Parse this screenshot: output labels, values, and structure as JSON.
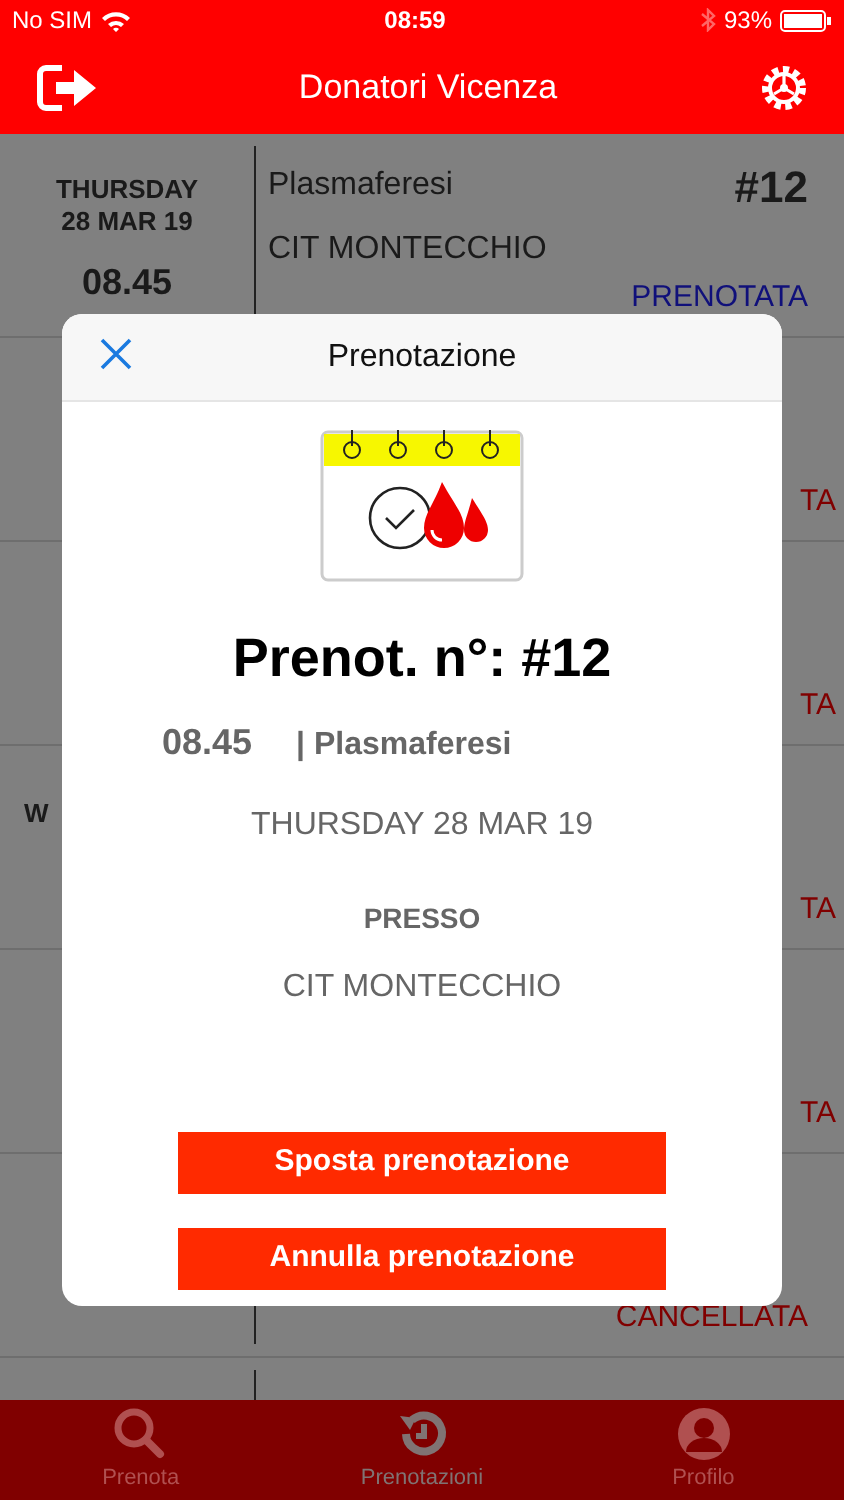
{
  "status_bar": {
    "carrier": "No SIM",
    "time": "08:59",
    "battery": "93%"
  },
  "header": {
    "title": "Donatori Vicenza"
  },
  "bookings": [
    {
      "day": "THURSDAY",
      "date": "28 MAR 19",
      "time": "08.45",
      "type": "Plasmaferesi",
      "place": "CIT MONTECCHIO",
      "number": "#12",
      "status": "PRENOTATA",
      "color": "#10107a"
    },
    {
      "status": "TA",
      "color": "#800000"
    },
    {
      "status": "TA",
      "color": "#800000"
    },
    {
      "day": "W",
      "status": "TA",
      "color": "#800000"
    },
    {
      "status": "TA",
      "color": "#800000"
    },
    {
      "status": "CANCELLATA",
      "color": "#800000"
    }
  ],
  "dialog": {
    "title": "Prenotazione",
    "heading": "Prenot. n°: #12",
    "time": "08.45",
    "type": "| Plasmaferesi",
    "date": "THURSDAY 28 MAR 19",
    "place_label": "PRESSO",
    "place": "CIT MONTECCHIO",
    "buttons": [
      "Sposta prenotazione",
      "Annulla prenotazione"
    ]
  },
  "tabs": [
    {
      "label": "Prenota",
      "selected": false
    },
    {
      "label": "Prenotazioni",
      "selected": true
    },
    {
      "label": "Profilo",
      "selected": false
    }
  ]
}
